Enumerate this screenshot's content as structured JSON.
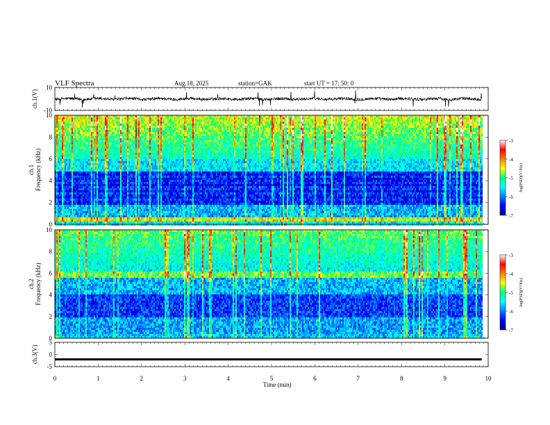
{
  "header": {
    "title": "VLF  Spectra",
    "date": "Aug.18, 2025",
    "station": "station=GAK",
    "start": "start  UT  =    17: 50: 0"
  },
  "colorbar": {
    "label": "log(PSD)(V²/Hz)",
    "ticks": [
      "-3",
      "-4",
      "-5",
      "-6",
      "-7"
    ]
  },
  "chart_data": [
    {
      "type": "line",
      "panel": "ch1-waveform",
      "ylabel": "ch.1(V)",
      "ylim": [
        -10,
        10
      ],
      "yticks": [
        "10",
        "-10"
      ],
      "xlim": [
        0,
        10
      ],
      "baseline": 0,
      "series": [
        {
          "values_desc": "noisy waveform near 0 V with brief spikes"
        }
      ]
    },
    {
      "type": "heatmap",
      "panel": "ch1-spectrogram",
      "ylabel": "ch.1\nFrequency (kHz)",
      "ylim": [
        0,
        10
      ],
      "yticks": [
        "0",
        "2",
        "4",
        "6",
        "8",
        "10"
      ],
      "xlim": [
        0,
        9.85
      ],
      "zlim": [
        -7,
        -3
      ]
    },
    {
      "type": "heatmap",
      "panel": "ch2-spectrogram",
      "ylabel": "ch.2\nFrequency (kHz)",
      "ylim": [
        0,
        10
      ],
      "yticks": [
        "0",
        "2",
        "4",
        "6",
        "8",
        "10"
      ],
      "xlim": [
        0,
        9.85
      ],
      "zlim": [
        -7,
        -3
      ]
    },
    {
      "type": "line",
      "panel": "ch3-waveform",
      "ylabel": "ch.3(V)",
      "ylim": [
        -5,
        5
      ],
      "yticks": [
        "5",
        "0",
        "-5"
      ],
      "xlim": [
        0,
        10
      ],
      "baseline": -2
    }
  ],
  "xaxis": {
    "label": "Time  (min)",
    "ticks": [
      "0",
      "1",
      "2",
      "3",
      "4",
      "5",
      "6",
      "7",
      "8",
      "9",
      "10"
    ]
  }
}
